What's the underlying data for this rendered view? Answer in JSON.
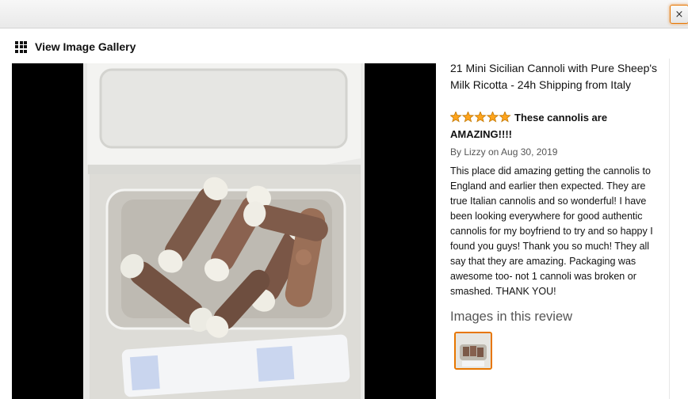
{
  "window": {
    "close_icon": "×"
  },
  "gallery": {
    "icon": "grid-icon",
    "label": "View Image Gallery"
  },
  "review": {
    "product_title": "21 Mini Sicilian Cannoli with Pure Sheep's Milk Ricotta - 24h Shipping from Italy",
    "rating": 5,
    "rating_max": 5,
    "star_color": "#ffa41c",
    "headline": "These cannolis are AMAZING!!!!",
    "byline": "By Lizzy on Aug 30, 2019",
    "body": "This place did amazing getting the cannolis to England and earlier then expected. They are true Italian cannolis and so wonderful! I have been looking everywhere for good authentic cannolis for my boyfriend to try and so happy I found you guys! Thank you so much! They all say that they are amazing. Packaging was awesome too- not 1 cannoli was broken or smashed. THANK YOU!",
    "images_heading": "Images in this review"
  },
  "colors": {
    "accent": "#e77600",
    "photo_background": "#000000"
  }
}
